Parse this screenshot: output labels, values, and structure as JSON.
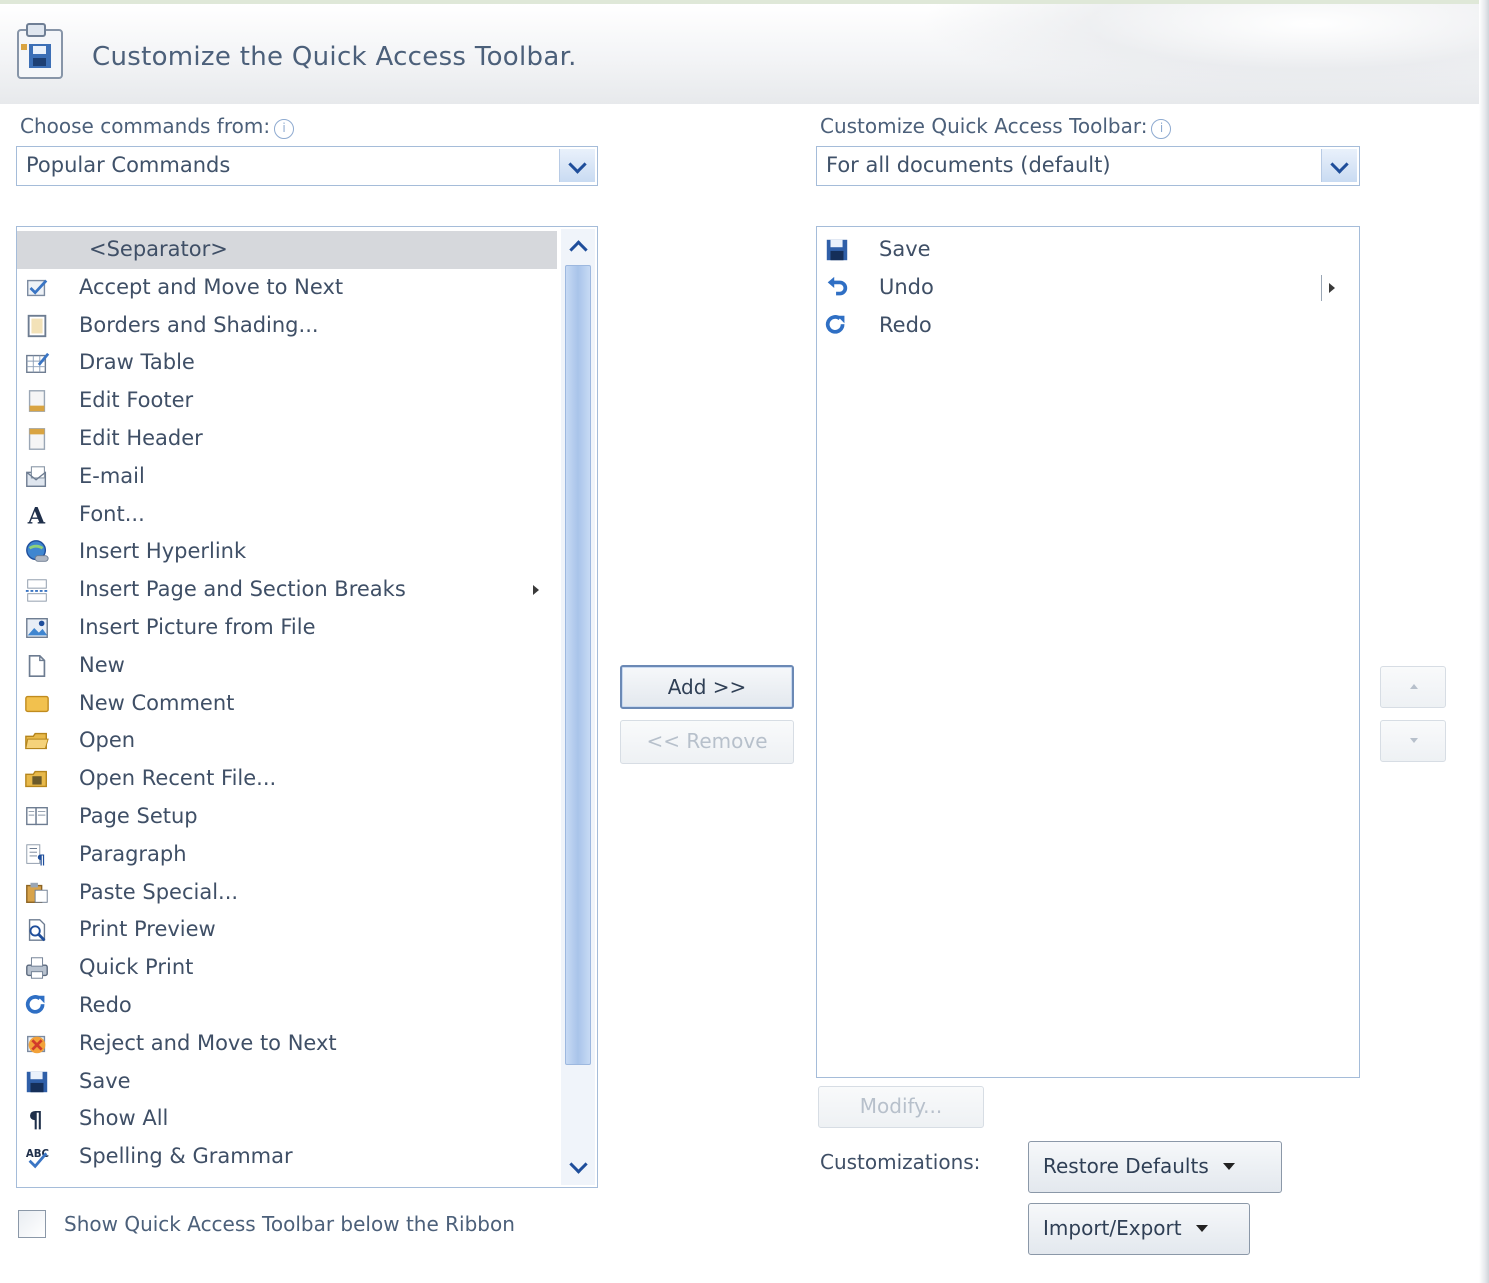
{
  "dialog": {
    "title": "Customize the Quick Access Toolbar.",
    "icon": "quick-access-toolbar-icon"
  },
  "left": {
    "label": "Choose commands from:",
    "info": "i",
    "dropdown_value": "Popular Commands",
    "items": [
      {
        "label": "<Separator>",
        "icon": "none",
        "selected": true
      },
      {
        "label": "Accept and Move to Next",
        "icon": "accept-change-icon"
      },
      {
        "label": "Borders and Shading...",
        "icon": "borders-icon"
      },
      {
        "label": "Draw Table",
        "icon": "draw-table-icon"
      },
      {
        "label": "Edit Footer",
        "icon": "footer-icon"
      },
      {
        "label": "Edit Header",
        "icon": "header-icon"
      },
      {
        "label": "E-mail",
        "icon": "email-icon"
      },
      {
        "label": "Font...",
        "icon": "font-icon"
      },
      {
        "label": "Insert Hyperlink",
        "icon": "hyperlink-icon"
      },
      {
        "label": "Insert Page and Section Breaks",
        "icon": "page-break-icon",
        "submenu": true
      },
      {
        "label": "Insert Picture from File",
        "icon": "picture-icon"
      },
      {
        "label": "New",
        "icon": "new-document-icon"
      },
      {
        "label": "New Comment",
        "icon": "new-comment-icon"
      },
      {
        "label": "Open",
        "icon": "open-folder-icon"
      },
      {
        "label": "Open Recent File...",
        "icon": "recent-file-icon"
      },
      {
        "label": "Page Setup",
        "icon": "page-setup-icon"
      },
      {
        "label": "Paragraph",
        "icon": "paragraph-icon"
      },
      {
        "label": "Paste Special...",
        "icon": "paste-special-icon"
      },
      {
        "label": "Print Preview",
        "icon": "print-preview-icon"
      },
      {
        "label": "Quick Print",
        "icon": "quick-print-icon"
      },
      {
        "label": "Redo",
        "icon": "redo-icon"
      },
      {
        "label": "Reject and Move to Next",
        "icon": "reject-change-icon"
      },
      {
        "label": "Save",
        "icon": "save-icon"
      },
      {
        "label": "Show All",
        "icon": "pilcrow-icon"
      },
      {
        "label": "Spelling & Grammar",
        "icon": "spelling-icon"
      }
    ]
  },
  "right": {
    "label": "Customize Quick Access Toolbar:",
    "info": "i",
    "dropdown_value": "For all documents (default)",
    "items": [
      {
        "label": "Save",
        "icon": "save-icon"
      },
      {
        "label": "Undo",
        "icon": "undo-icon",
        "split": true
      },
      {
        "label": "Redo",
        "icon": "redo-icon"
      }
    ]
  },
  "buttons": {
    "add": "Add >>",
    "remove": "<< Remove",
    "modify": "Modify...",
    "restore": "Restore Defaults",
    "import_export": "Import/Export"
  },
  "customizations_label": "Customizations:",
  "checkbox": {
    "label": "Show Quick Access Toolbar below the Ribbon",
    "checked": false
  },
  "colors": {
    "accent": "#1f4e9b",
    "border": "#a5bcd9",
    "selection": "#d6d8dc"
  }
}
